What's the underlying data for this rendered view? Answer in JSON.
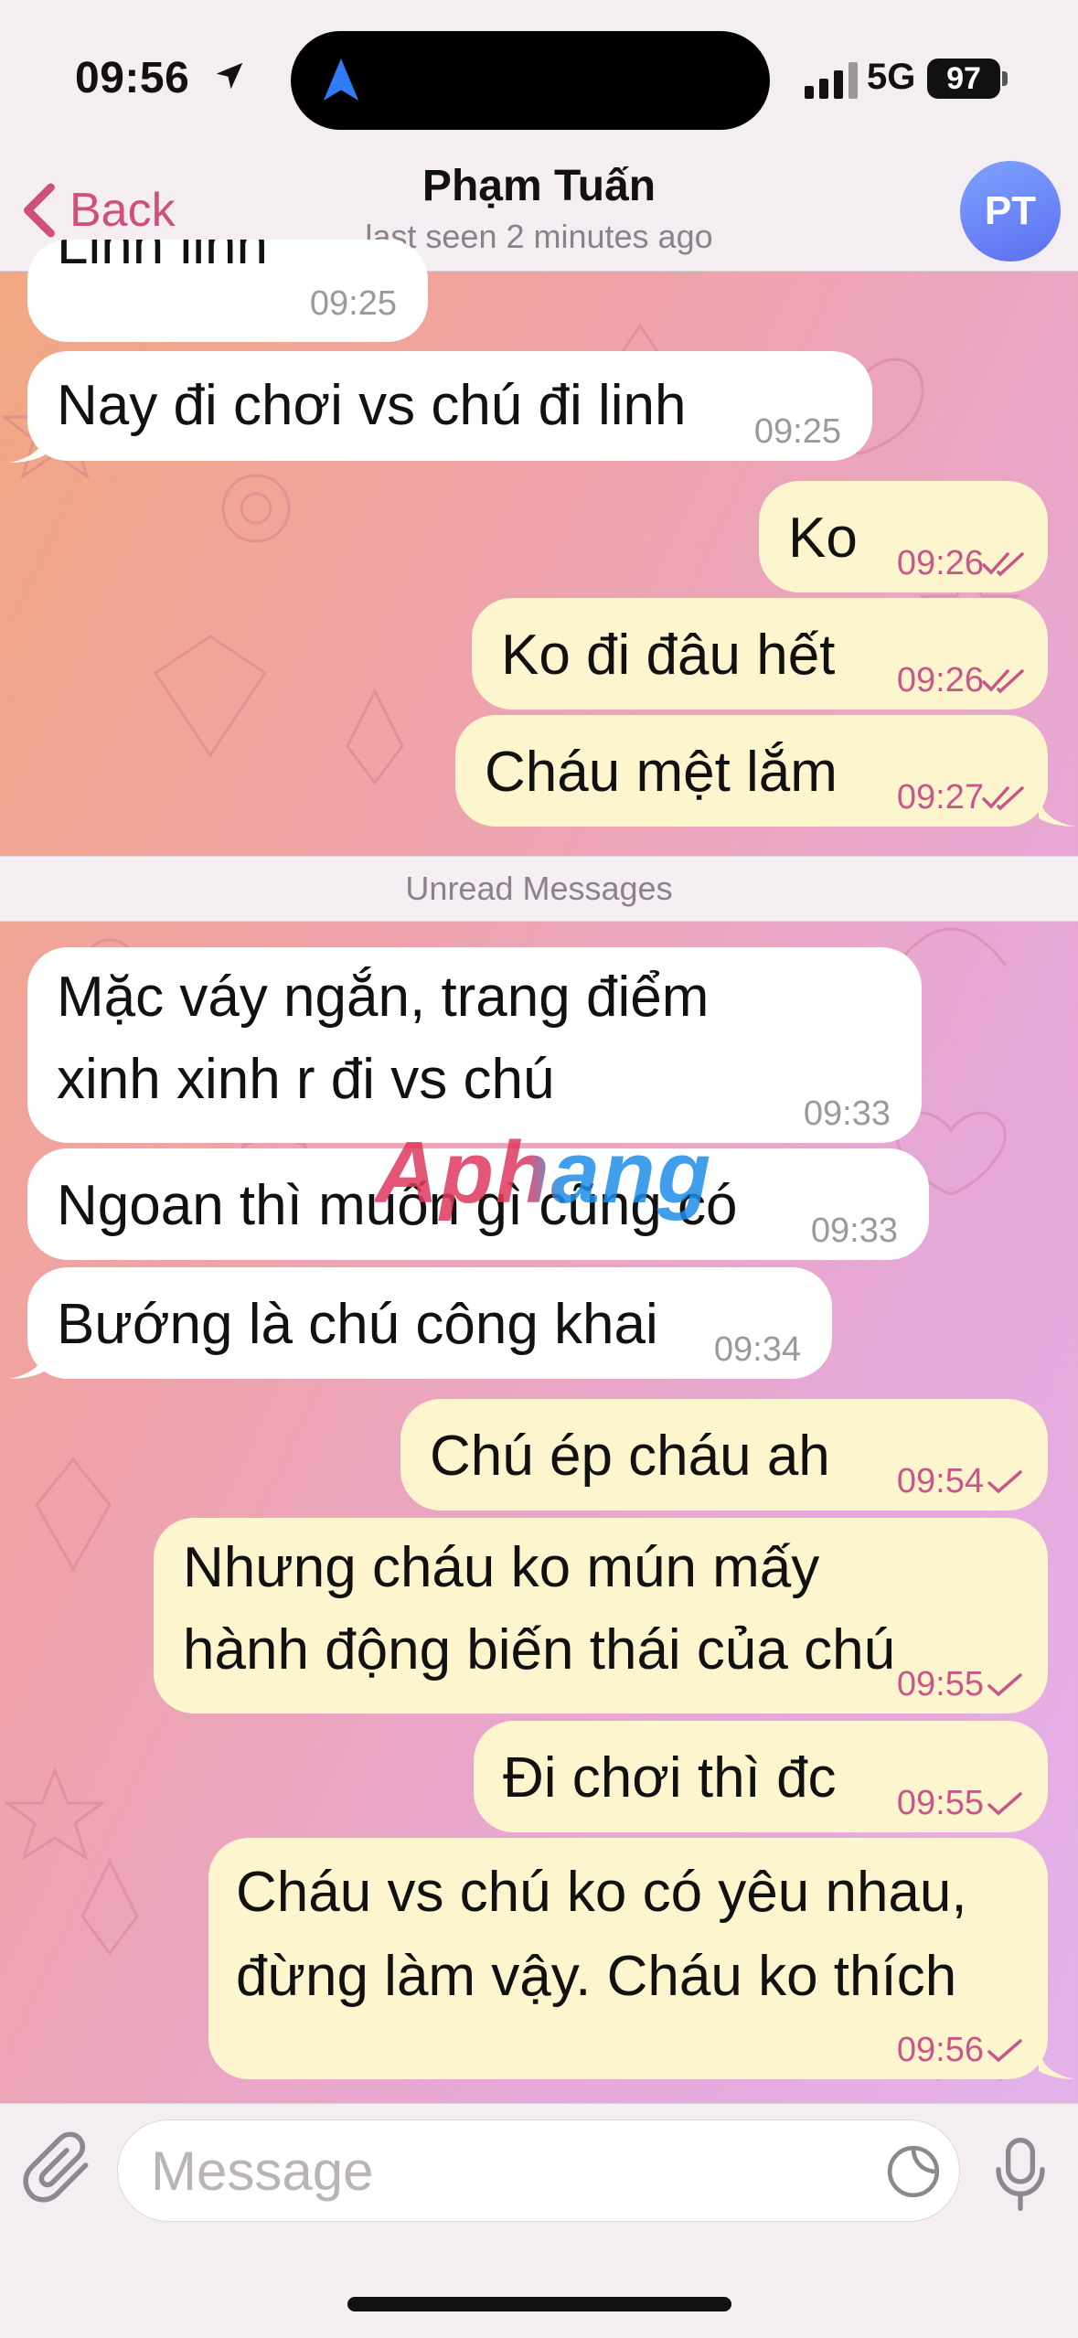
{
  "status_bar": {
    "time": "09:56",
    "network": "5G",
    "battery": "97"
  },
  "header": {
    "back_label": "Back",
    "contact_name": "Phạm Tuấn",
    "last_seen": "last seen 2 minutes ago",
    "avatar_initials": "PT"
  },
  "unread_label": "Unread Messages",
  "messages": [
    {
      "dir": "in",
      "text": "Linh linh",
      "time": "09:25"
    },
    {
      "dir": "in",
      "text": "Nay đi chơi vs chú đi linh",
      "time": "09:25"
    },
    {
      "dir": "out",
      "text": "Ko",
      "time": "09:26",
      "status": "read"
    },
    {
      "dir": "out",
      "text": "Ko đi đâu hết",
      "time": "09:26",
      "status": "read"
    },
    {
      "dir": "out",
      "text": "Cháu mệt lắm",
      "time": "09:27",
      "status": "read"
    },
    {
      "dir": "in",
      "text": "Mặc váy ngắn, trang điểm xinh xinh r đi vs chú",
      "time": "09:33"
    },
    {
      "dir": "in",
      "text": "Ngoan thì muốn gì cũng có",
      "time": "09:33"
    },
    {
      "dir": "in",
      "text": "Bướng là chú công khai",
      "time": "09:34"
    },
    {
      "dir": "out",
      "text": "Chú ép cháu ah",
      "time": "09:54",
      "status": "sent"
    },
    {
      "dir": "out",
      "text": "Nhưng cháu ko mún mấy hành động biến thái của chú",
      "time": "09:55",
      "status": "sent"
    },
    {
      "dir": "out",
      "text": "Đi chơi thì đc",
      "time": "09:55",
      "status": "sent"
    },
    {
      "dir": "out",
      "text": "Cháu vs chú ko có yêu nhau, đừng làm vậy. Cháu ko thích",
      "time": "09:56",
      "status": "sent"
    }
  ],
  "watermark": "Aphang",
  "composer": {
    "placeholder": "Message"
  },
  "colors": {
    "accent": "#d0507c",
    "incoming_bubble": "#ffffff",
    "outgoing_bubble": "#fdf5cd",
    "outgoing_time": "#c9568a"
  },
  "icons": [
    "location-arrow-icon",
    "signal-icon",
    "back-chevron-icon",
    "double-check-icon",
    "single-check-icon",
    "paperclip-icon",
    "sticker-icon",
    "microphone-icon"
  ]
}
